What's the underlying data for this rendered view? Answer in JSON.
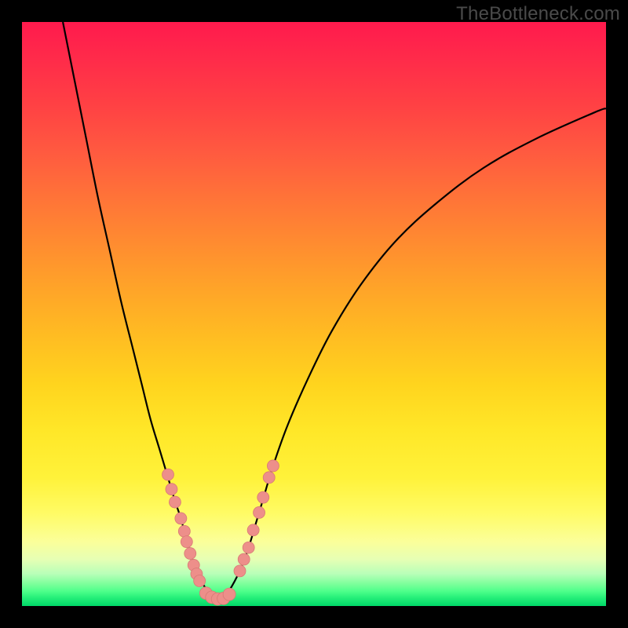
{
  "watermark": "TheBottleneck.com",
  "colors": {
    "gradient_top": "#ff1a4d",
    "gradient_mid": "#ffd41e",
    "gradient_bottom": "#00d868",
    "curve": "#000000",
    "marker_fill": "#ed8f8a",
    "marker_stroke": "#d87a75",
    "frame": "#000000"
  },
  "chart_data": {
    "type": "line",
    "title": "",
    "xlabel": "",
    "ylabel": "",
    "xlim": [
      0,
      100
    ],
    "ylim": [
      0,
      100
    ],
    "grid": false,
    "legend": false,
    "series": [
      {
        "name": "left-curve",
        "x": [
          7,
          9,
          11,
          13,
          15,
          17,
          19,
          20.5,
          22,
          23.5,
          25,
          26.2,
          27.2,
          28,
          28.7,
          29.3,
          29.8,
          30.3,
          31.5,
          33.5
        ],
        "y": [
          100,
          90,
          80,
          70,
          61,
          52,
          44,
          38,
          32,
          27,
          22,
          18,
          15,
          12,
          9.5,
          7.5,
          6,
          5,
          3,
          1.2
        ]
      },
      {
        "name": "right-curve",
        "x": [
          34.5,
          36,
          37.5,
          38.8,
          40,
          41.2,
          43,
          45.5,
          49,
          53,
          58,
          64,
          71,
          79,
          88,
          98,
          100
        ],
        "y": [
          1.2,
          3.5,
          6.5,
          10,
          14,
          18,
          24,
          31,
          39,
          47,
          55,
          62.5,
          69,
          75,
          80,
          84.5,
          85.2
        ]
      }
    ],
    "markers": {
      "left_cluster": [
        {
          "x": 25.0,
          "y": 22.5
        },
        {
          "x": 25.6,
          "y": 20.0
        },
        {
          "x": 26.2,
          "y": 17.8
        },
        {
          "x": 27.2,
          "y": 15.0
        },
        {
          "x": 27.8,
          "y": 12.8
        },
        {
          "x": 28.2,
          "y": 11.0
        },
        {
          "x": 28.8,
          "y": 9.0
        },
        {
          "x": 29.4,
          "y": 7.0
        },
        {
          "x": 29.9,
          "y": 5.5
        },
        {
          "x": 30.4,
          "y": 4.3
        }
      ],
      "right_cluster": [
        {
          "x": 37.3,
          "y": 6.0
        },
        {
          "x": 38.0,
          "y": 8.0
        },
        {
          "x": 38.8,
          "y": 10.0
        },
        {
          "x": 39.6,
          "y": 13.0
        },
        {
          "x": 40.6,
          "y": 16.0
        },
        {
          "x": 41.3,
          "y": 18.6
        },
        {
          "x": 42.3,
          "y": 22.0
        },
        {
          "x": 43.0,
          "y": 24.0
        }
      ],
      "bottom_cluster": [
        {
          "x": 31.5,
          "y": 2.2
        },
        {
          "x": 32.5,
          "y": 1.5
        },
        {
          "x": 33.5,
          "y": 1.2
        },
        {
          "x": 34.5,
          "y": 1.3
        },
        {
          "x": 35.5,
          "y": 2.0
        }
      ]
    }
  }
}
